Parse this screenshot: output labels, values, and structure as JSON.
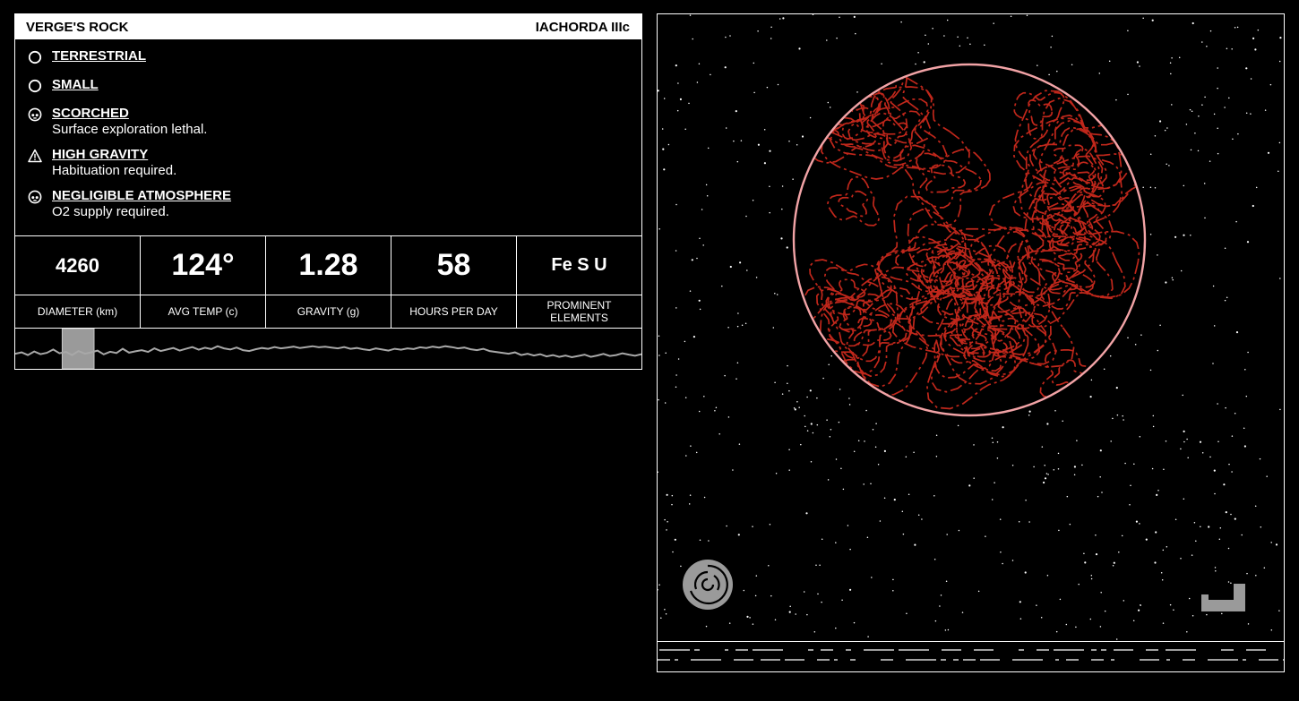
{
  "header": {
    "planet_name": "VERGE'S ROCK",
    "system_designation": "IACHORDA IIIc"
  },
  "traits": [
    {
      "icon": "circle-icon",
      "name": "TERRESTRIAL",
      "description": ""
    },
    {
      "icon": "circle-icon",
      "name": "SMALL",
      "description": ""
    },
    {
      "icon": "skull-icon",
      "name": "SCORCHED",
      "description": "Surface exploration lethal."
    },
    {
      "icon": "warning-icon",
      "name": "HIGH GRAVITY",
      "description": "Habituation required."
    },
    {
      "icon": "skull-icon",
      "name": "NEGLIGIBLE ATMOSPHERE",
      "description": "O2 supply required."
    }
  ],
  "stats": [
    {
      "value": "4260",
      "label": "DIAMETER (km)"
    },
    {
      "value": "124°",
      "label": "AVG TEMP (c)"
    },
    {
      "value": "1.28",
      "label": "GRAVITY (g)"
    },
    {
      "value": "58",
      "label": "HOURS PER DAY"
    },
    {
      "value": "Fe S U",
      "label": "PROMINENT ELEMENTS"
    }
  ],
  "elevation_profile": {
    "values": [
      0.36,
      0.42,
      0.3,
      0.46,
      0.34,
      0.4,
      0.55,
      0.38,
      0.44,
      0.3,
      0.48,
      0.36,
      0.42,
      0.5,
      0.33,
      0.45,
      0.39,
      0.58,
      0.41,
      0.47,
      0.52,
      0.44,
      0.6,
      0.48,
      0.55,
      0.62,
      0.5,
      0.58,
      0.66,
      0.54,
      0.63,
      0.57,
      0.7,
      0.6,
      0.55,
      0.64,
      0.52,
      0.48,
      0.56,
      0.62,
      0.58,
      0.66,
      0.6,
      0.64,
      0.68,
      0.62,
      0.66,
      0.7,
      0.65,
      0.68,
      0.64,
      0.6,
      0.66,
      0.58,
      0.62,
      0.56,
      0.52,
      0.6,
      0.55,
      0.5,
      0.58,
      0.54,
      0.6,
      0.57,
      0.65,
      0.62,
      0.68,
      0.64,
      0.7,
      0.66,
      0.6,
      0.64,
      0.56,
      0.52,
      0.58,
      0.48,
      0.44,
      0.4,
      0.36,
      0.42,
      0.3,
      0.36,
      0.28,
      0.34,
      0.24,
      0.3,
      0.22,
      0.28,
      0.2,
      0.26,
      0.32,
      0.22,
      0.28,
      0.35,
      0.26,
      0.3,
      0.38,
      0.32,
      0.27,
      0.34
    ],
    "selection_start": 0.075,
    "selection_end": 0.126
  },
  "colors": {
    "planet_outline": "#f2a3a6",
    "contour": "#c0271b",
    "ui_gray": "#9a9a9a"
  }
}
